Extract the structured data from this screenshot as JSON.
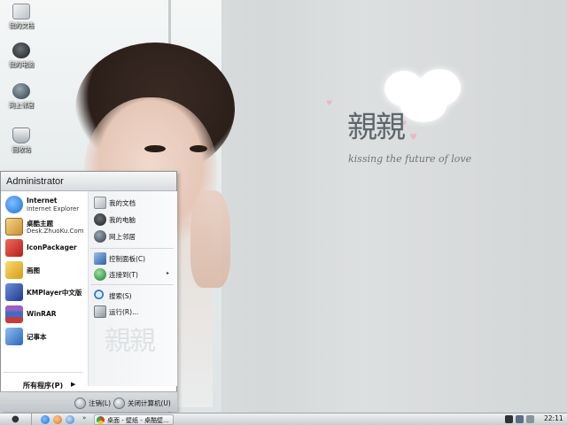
{
  "desktop": {
    "icons": [
      {
        "label": "我的文档",
        "icon": "my-documents-icon"
      },
      {
        "label": "我的电脑",
        "icon": "my-computer-icon"
      },
      {
        "label": "网上邻居",
        "icon": "network-places-icon"
      },
      {
        "label": "回收站",
        "icon": "recycle-bin-icon"
      }
    ],
    "wallpaper": {
      "logo_chars": "親親",
      "tagline": "kissing the future of love"
    }
  },
  "start_menu": {
    "user": "Administrator",
    "pinned": [
      {
        "name": "Internet",
        "sub": "Internet Explorer",
        "icon": "internet-explorer-icon",
        "color": "#1f6fd1"
      },
      {
        "name": "桌酷主题",
        "sub": "Desk.ZhuoKu.Com",
        "icon": "zhuoku-theme-icon",
        "color": "#d9a441"
      },
      {
        "name": "IconPackager",
        "sub": "",
        "icon": "iconpackager-icon",
        "color": "#d4322c"
      },
      {
        "name": "画图",
        "sub": "",
        "icon": "paint-icon",
        "color": "#e8b631"
      },
      {
        "name": "KMPlayer中文版",
        "sub": "",
        "icon": "kmplayer-icon",
        "color": "#2b4fa8"
      },
      {
        "name": "WinRAR",
        "sub": "",
        "icon": "winrar-icon",
        "color": "#7a3e9d"
      },
      {
        "name": "记事本",
        "sub": "",
        "icon": "notepad-icon",
        "color": "#3a78c8"
      }
    ],
    "all_programs": "所有程序(P)",
    "right_items": [
      {
        "label": "我的文档",
        "icon": "my-documents-icon",
        "color": "#c9ced3",
        "arrow": ""
      },
      {
        "label": "我的电脑",
        "icon": "my-computer-icon",
        "color": "#2c2f33",
        "arrow": ""
      },
      {
        "label": "网上邻居",
        "icon": "network-places-icon",
        "color": "#4c5a66",
        "arrow": ""
      },
      {
        "label": "控制面板(C)",
        "icon": "control-panel-icon",
        "color": "#4a7ec2",
        "arrow": ""
      },
      {
        "label": "连接到(T)",
        "icon": "connect-to-icon",
        "color": "#2f8f3e",
        "arrow": "▸"
      },
      {
        "label": "搜索(S)",
        "icon": "search-icon",
        "color": "#3b78c9",
        "arrow": ""
      },
      {
        "label": "运行(R)...",
        "icon": "run-icon",
        "color": "#8d959c",
        "arrow": ""
      }
    ],
    "watermark": "親親",
    "logoff_label": "注销(L)",
    "shutdown_label": "关闭计算机(U)"
  },
  "taskbar": {
    "start_icon": "apple-icon",
    "quick_launch": [
      "internet-explorer-icon",
      "firefox-icon",
      "show-desktop-icon"
    ],
    "chevron": "»",
    "task_label": "桌面 - 壁纸 - 桌酷壁...",
    "clock": "22:11"
  }
}
